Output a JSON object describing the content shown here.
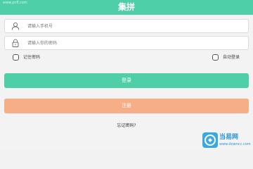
{
  "header": {
    "title": "集拼",
    "watermark": "www.pc6.com"
  },
  "form": {
    "phone_placeholder": "请输入手机号",
    "password_placeholder": "请输入你的密码"
  },
  "options": {
    "remember_label": "记住密码",
    "auto_login_label": "自动登录"
  },
  "buttons": {
    "login_label": "登录",
    "register_label": "注册"
  },
  "links": {
    "forgot_password": "忘记密码?"
  },
  "watermark": {
    "name": "当易网",
    "url": "www.downcc.com"
  },
  "colors": {
    "accent": "#4fcfa7",
    "register": "#f5ae86",
    "background": "#f3f3f3"
  },
  "icons": {
    "phone_field": "user-icon",
    "password_field": "lock-icon"
  }
}
